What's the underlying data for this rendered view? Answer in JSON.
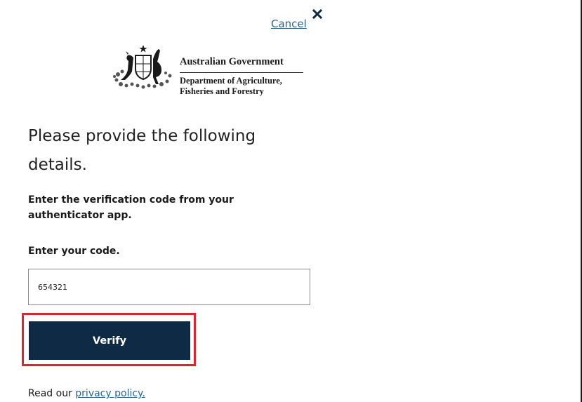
{
  "header": {
    "cancel_label": "Cancel",
    "close_icon": "close-icon"
  },
  "logo": {
    "government": "Australian Government",
    "department_line1": "Department of Agriculture,",
    "department_line2": "Fisheries and Forestry",
    "icon": "coat-of-arms-icon"
  },
  "form": {
    "heading": "Please provide the following details.",
    "instruction": "Enter the verification code from your authenticator app.",
    "code_label": "Enter your code.",
    "code_value": "654321",
    "verify_label": "Verify"
  },
  "footer": {
    "prefix": "Read our",
    "privacy_link": "privacy policy."
  },
  "colors": {
    "primary_button": "#0e2a45",
    "link": "#2a6496",
    "highlight": "#e0232d"
  }
}
